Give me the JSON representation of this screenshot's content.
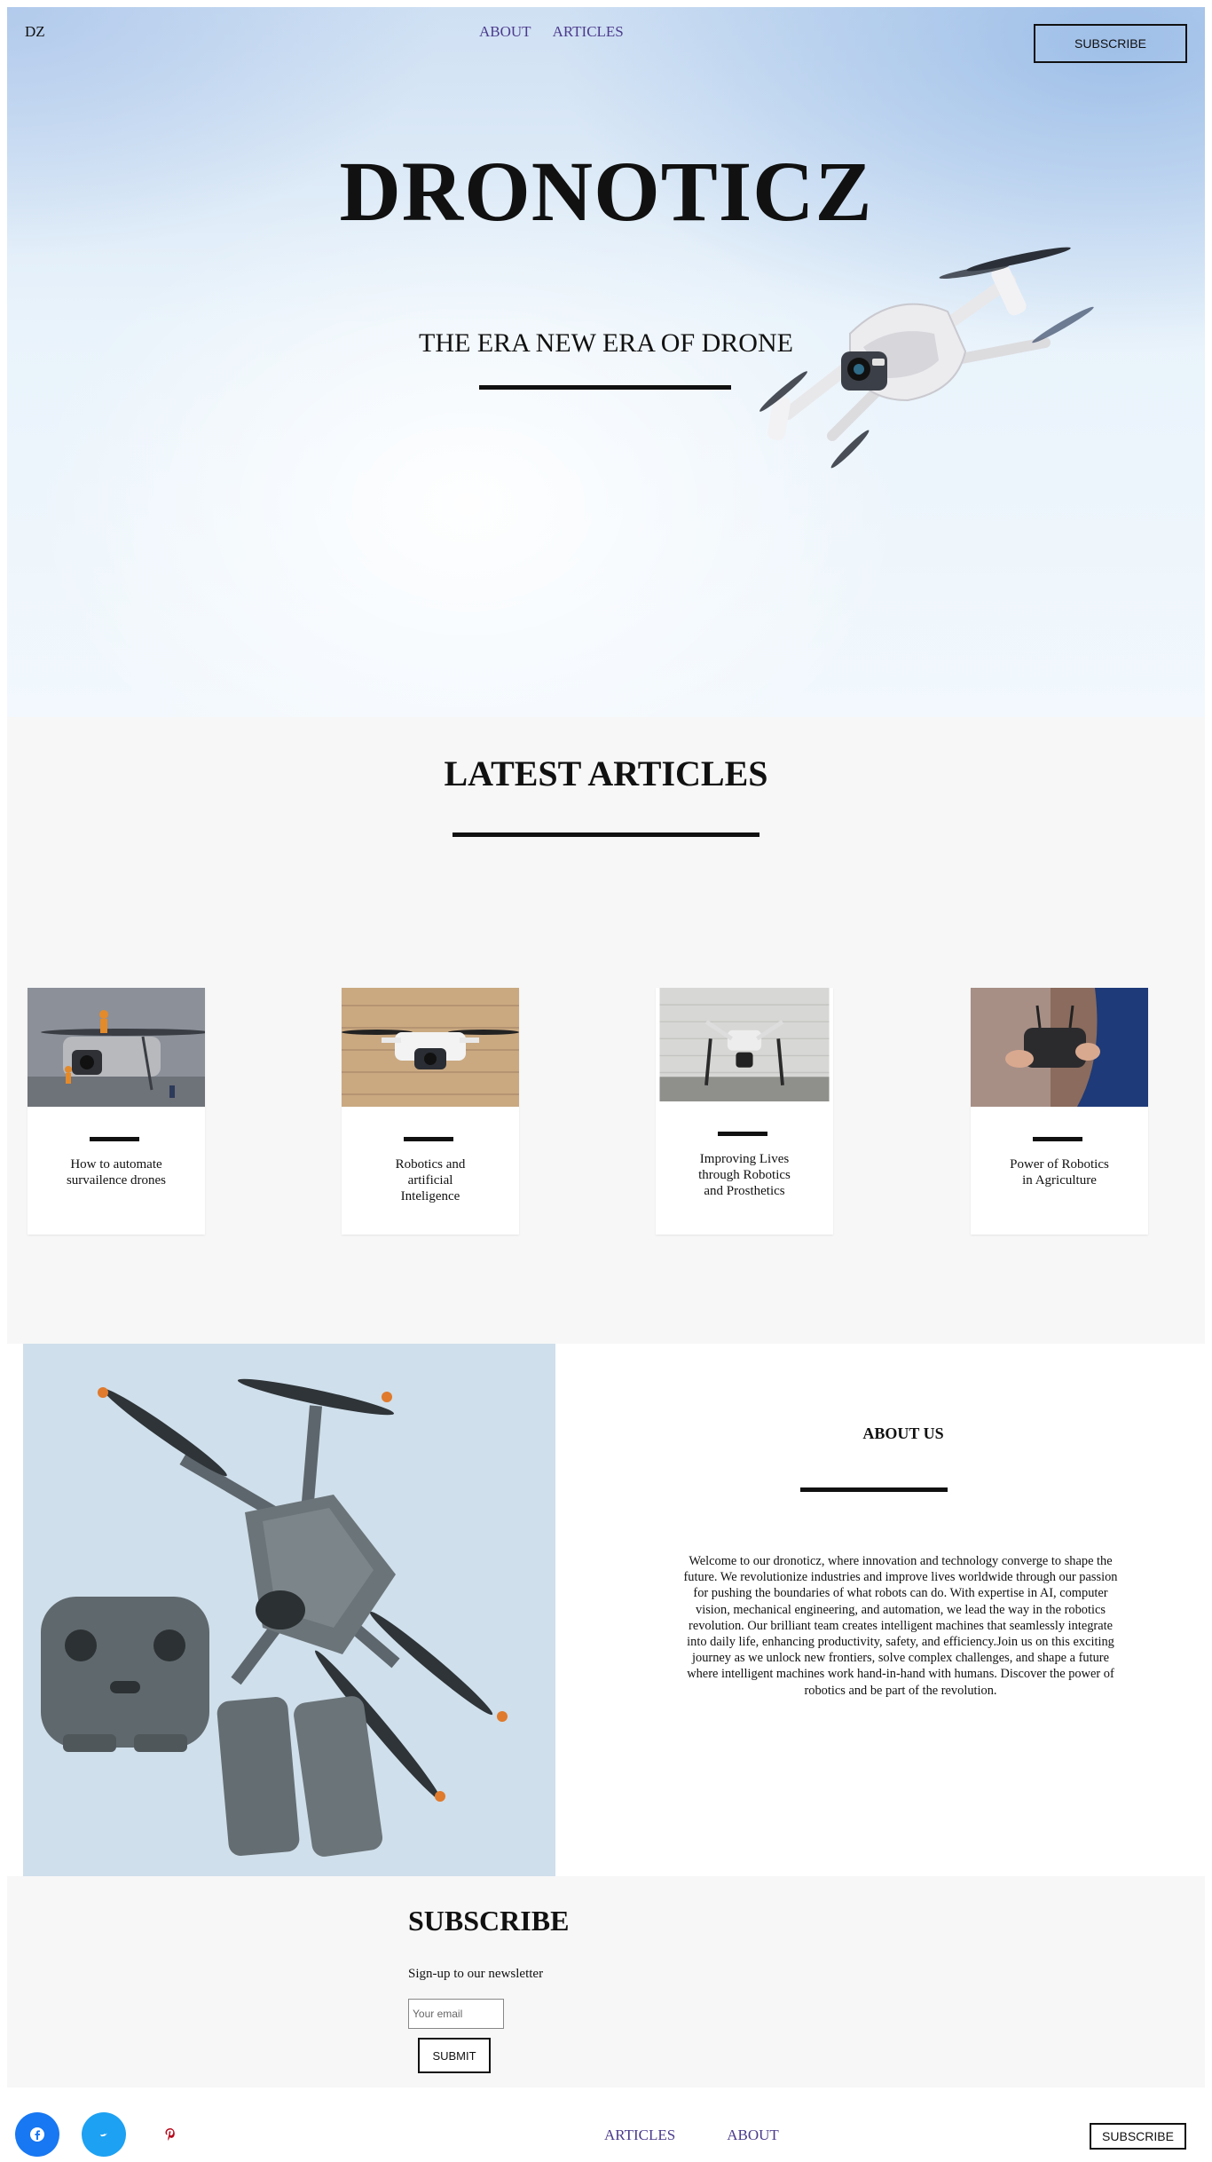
{
  "nav": {
    "logo": "DZ",
    "links": [
      "ABOUT",
      "ARTICLES"
    ],
    "subscribe_label": "SUBSCRIBE"
  },
  "hero": {
    "title": "DRONOTICZ",
    "subtitle": "THE ERA NEW ERA OF DRONE"
  },
  "articles": {
    "title": "LATEST ARTICLES",
    "items": [
      {
        "title": "How to automate survailence drones"
      },
      {
        "title": "Robotics and artificial Inteligence"
      },
      {
        "title": "Improving Lives through Robotics and Prosthetics"
      },
      {
        "title": "Power of Robotics in Agriculture"
      }
    ]
  },
  "about": {
    "title": "ABOUT US",
    "text": "Welcome to our dronoticz, where innovation and technology converge to shape the future. We revolutionize industries and improve lives worldwide through our passion for pushing the boundaries of what robots can do. With expertise in AI, computer vision, mechanical engineering, and automation, we lead the way in the robotics revolution. Our brilliant team creates intelligent machines that seamlessly integrate into daily life, enhancing productivity, safety, and efficiency.Join us on this exciting journey as we unlock new frontiers, solve complex challenges, and shape a future where intelligent machines work hand-in-hand with humans. Discover the power of robotics and be part of the revolution."
  },
  "subscribe": {
    "title": "SUBSCRIBE",
    "text": "Sign-up to our newsletter",
    "email_placeholder": "Your email",
    "submit_label": "SUBMIT"
  },
  "footer": {
    "social": [
      "facebook-icon",
      "twitter-icon",
      "pinterest-icon"
    ],
    "links": [
      "ARTICLES",
      "ABOUT"
    ],
    "subscribe_label": "SUBSCRIBE"
  },
  "colors": {
    "link": "#4b3a8c",
    "facebook": "#1877f2",
    "twitter": "#1da1f2",
    "pinterest": "#b7081b"
  }
}
